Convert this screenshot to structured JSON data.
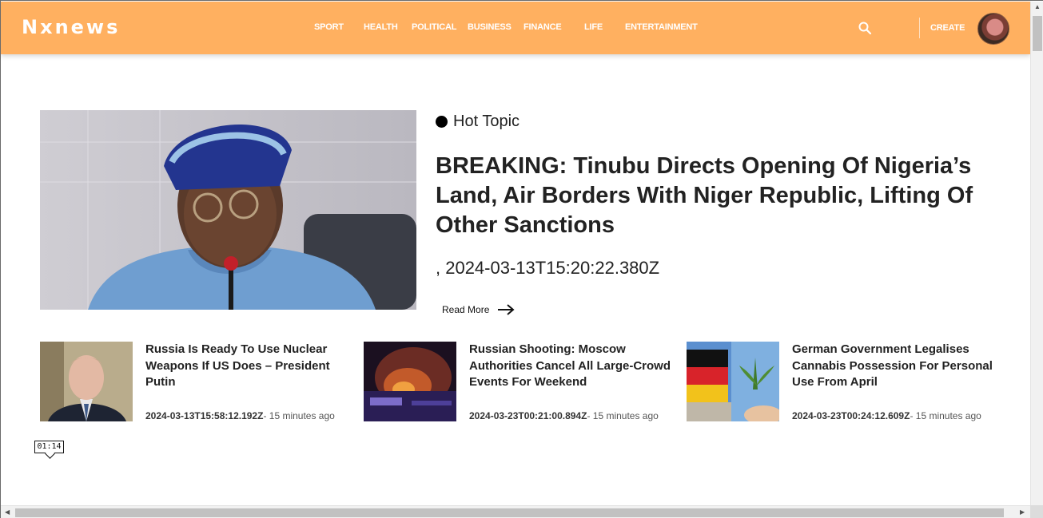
{
  "site": {
    "logo": "Nxnews"
  },
  "nav": {
    "items": [
      {
        "label": "SPORT"
      },
      {
        "label": "HEALTH"
      },
      {
        "label": "POLITICAL"
      },
      {
        "label": "BUSINESS"
      },
      {
        "label": "FINANCE"
      },
      {
        "label": "LIFE"
      },
      {
        "label": "ENTERTAINMENT"
      }
    ],
    "create_label": "CREATE",
    "icons": {
      "search": "search-icon",
      "theme": "moon-icon",
      "avatar": "avatar"
    }
  },
  "hero": {
    "badge": "Hot Topic",
    "title": "BREAKING: Tinubu Directs Opening Of Nigeria’s Land, Air Borders With Niger Republic, Lifting Of Other Sanctions",
    "date": ", 2024-03-13T15:20:22.380Z",
    "read_more": "Read More"
  },
  "articles": [
    {
      "title": "Russia Is Ready To Use Nuclear Weapons If US Does – President Putin",
      "timestamp": "2024-03-13T15:58:12.192Z",
      "relative": "- 15 minutes ago"
    },
    {
      "title": "Russian Shooting: Moscow Authorities Cancel All Large-Crowd Events For Weekend",
      "timestamp": "2024-03-23T00:21:00.894Z",
      "relative": "- 15 minutes ago"
    },
    {
      "title": "German Government Legalises Cannabis Possession For Personal Use From April",
      "timestamp": "2024-03-23T00:24:12.609Z",
      "relative": "- 15 minutes ago"
    }
  ],
  "timer": {
    "text": "01:14"
  },
  "colors": {
    "header_bg": "#ffb060",
    "header_text": "#ffffff",
    "text": "#222222"
  }
}
